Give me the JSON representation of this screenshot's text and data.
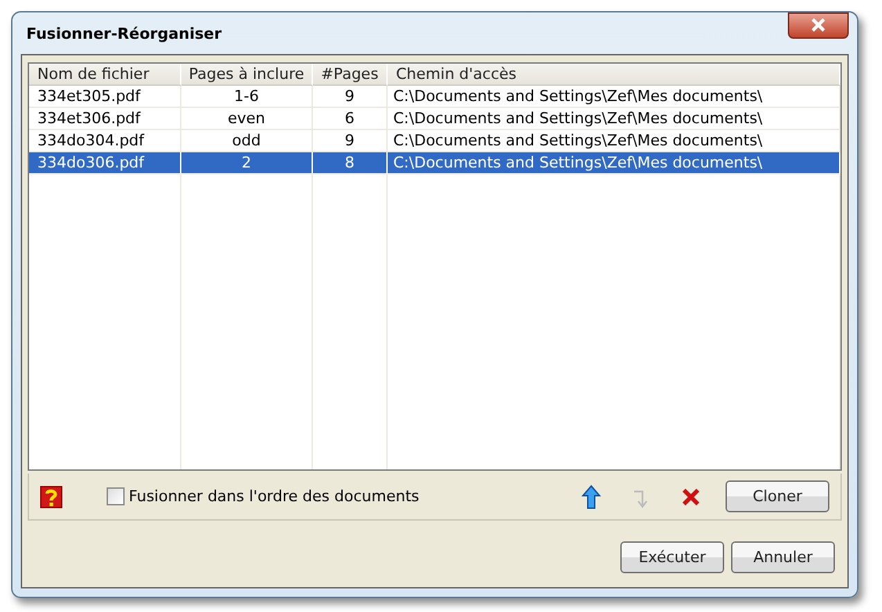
{
  "window": {
    "title": "Fusionner-Réorganiser"
  },
  "table": {
    "columns": [
      "Nom de fichier",
      "Pages à inclure",
      "#Pages",
      "Chemin d'accès"
    ],
    "rows": [
      {
        "cells": [
          "334et305.pdf",
          "1-6",
          "9",
          "C:\\Documents and Settings\\Zef\\Mes documents\\"
        ],
        "selected": false
      },
      {
        "cells": [
          "334et306.pdf",
          "even",
          "6",
          "C:\\Documents and Settings\\Zef\\Mes documents\\"
        ],
        "selected": false
      },
      {
        "cells": [
          "334do304.pdf",
          "odd",
          "9",
          "C:\\Documents and Settings\\Zef\\Mes documents\\"
        ],
        "selected": false
      },
      {
        "cells": [
          "334do306.pdf",
          "2",
          "8",
          "C:\\Documents and Settings\\Zef\\Mes documents\\"
        ],
        "selected": true
      }
    ]
  },
  "options": {
    "merge_in_document_order": {
      "label": "Fusionner dans l'ordre des documents",
      "checked": false
    }
  },
  "tools": [
    {
      "kind": "up",
      "disabled": false
    },
    {
      "kind": "down",
      "disabled": true
    },
    {
      "kind": "delete",
      "disabled": false
    }
  ],
  "clone_button": "Cloner",
  "buttons": [
    "Exécuter",
    "Annuler"
  ]
}
